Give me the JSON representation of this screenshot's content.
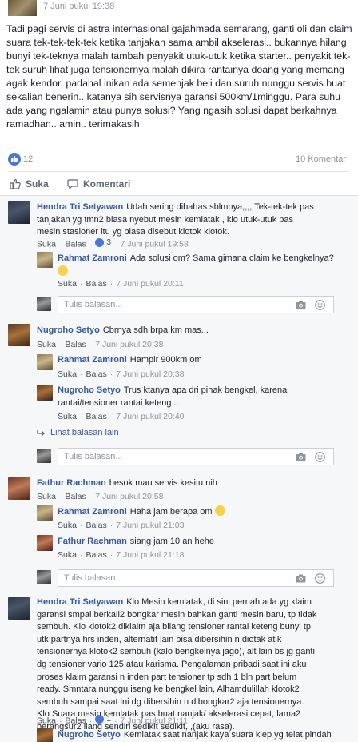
{
  "post": {
    "timestamp": "7 Juni pukul 19:38",
    "body": "Tadi pagi servis di astra internasional gajahmada semarang, ganti oli dan claim suara tek-tek-tek-tek ketika tanjakan sama ambil akselerasi.. bukannya hilang bunyi tek-teknya malah tambah penyakit utuk-utuk ketika starter.. penyakit tek-tek suruh lihat juga tensionernya malah dikira rantainya doang yang memang agak kendor, padahal inikan ada semenjak beli dan suruh nunggu servis buat sekalian benerin.. katanya sih servisnya garansi 500km/1minggu. Para suhu ada yang ngalamin atau punya solusi? Yang ngasih solusi dapat berkahnya ramadhan.. amin.. terimakasih",
    "likes": "12",
    "comments_count": "10 Komentar"
  },
  "actions": {
    "like": "Suka",
    "comment": "Komentari"
  },
  "labels": {
    "like": "Suka",
    "reply": "Balas",
    "reply_placeholder": "Tulis balasan..."
  },
  "comments": [
    {
      "name": "Hendra Tri Setyawan",
      "text": "Udah sering dibahas sblmnya,,,, Tek-tek-tek pas tanjakan yg tmn2 biasa nyebut mesin kemlatak , klo utuk-utuk pas mesin stasioner itu yg biasa disebut klotok klotok.",
      "likes": "3",
      "time": "7 Juni pukul 19:58",
      "replies": [
        {
          "name": "Rahmat Zamroni",
          "text": "Ada solusi om? Sama gimana claim ke bengkelnya?",
          "time": "7 Juni pukul 20:11"
        }
      ]
    },
    {
      "name": "Nugroho Setyo",
      "text": "Cbrnya sdh brpa km mas...",
      "time": "7 Juni pukul 20:38",
      "replies": [
        {
          "name": "Rahmat Zamroni",
          "text": "Hampir 900km om",
          "time": "7 Juni pukul 20:38"
        },
        {
          "name": "Nugroho Setyo",
          "text": "Trus ktanya apa dri pihak bengkel, karena rantai/tensioner rantai keteng...",
          "time": "7 Juni pukul 20:40"
        }
      ],
      "more_replies": "Lihat balasan lain"
    },
    {
      "name": "Fathur Rachman",
      "text": "besok mau servis kesitu nih",
      "time": "7 Juni pukul 20:58",
      "replies": [
        {
          "name": "Rahmat Zamroni",
          "text": "Haha jam berapa om",
          "time": "7 Juni pukul 21:03"
        },
        {
          "name": "Fathur Rachman",
          "text": "siang jam 10 an hehe",
          "time": "7 Juni pukul 21:18"
        }
      ]
    },
    {
      "name": "Hendra Tri Setyawan",
      "text": "Klo Mesin kemlatak, di sini pernah ada yg klaim garansi smpai berkali2 bongkar mesin bahkan ganti mesin baru, tp tidak sembuh. Klo klotok2 diklaim aja bilang tensioner rantai keteng bunyi tp utk partnya hrs inden, alternatif lain bisa dibersihin n diotak atik tensionernya klotok2 sembuh (kalo bengkelnya jago), alt lain bs jg ganti dg tensioner vario 125 atau karisma. Pengalaman pribadi saat ini aku proses klaim garansi n inden part tensioner tp sdh 1 bln part belum ready. Smntara nunggu iseng ke bengkel lain, Alhamdulillah klotok2 sembuh sampai saat ini dg dibersihin n dibongkar2 aja tensionernya. Klo Suara mesin kemlatak pas buat nanjak/ akselerasi cepat, lama2 berangsur2 ilang sendiri sedikit sedikit,,,(aku rasa).",
      "likes": "1",
      "time": "7 Juni pukul 21:11",
      "replies": [
        {
          "name": "Nugroho Setyo",
          "text": "Kemlatak saat nanjak kaya suara klep yg telat pindah"
        }
      ]
    }
  ],
  "icons": {
    "like": "thumbs-up-icon",
    "comment": "speech-bubble-icon",
    "camera": "camera-icon",
    "emoji": "smiley-icon",
    "reply_arrow": "reply-arrow-icon"
  },
  "colors": {
    "link": "#365899",
    "like_blue": "#4a76d6",
    "muted": "#90949c",
    "comments_bg": "#f6f7f9"
  }
}
